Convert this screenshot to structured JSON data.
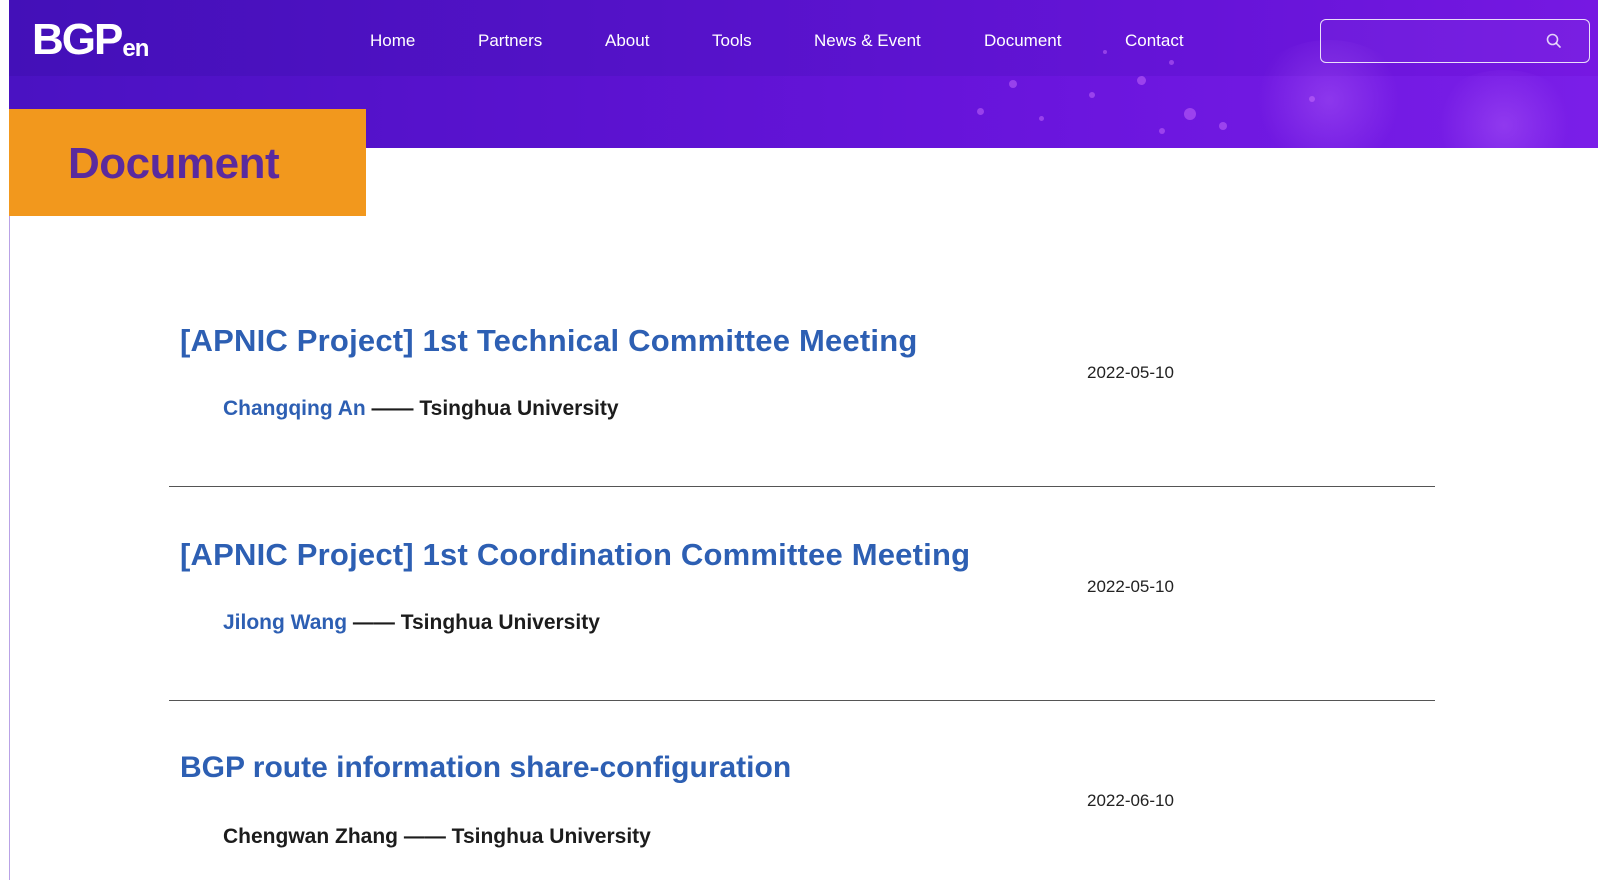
{
  "header": {
    "logo_main": "BGP",
    "logo_sub": "en",
    "nav": [
      {
        "label": "Home"
      },
      {
        "label": "Partners"
      },
      {
        "label": "About"
      },
      {
        "label": "Tools"
      },
      {
        "label": "News & Event"
      },
      {
        "label": "Document"
      },
      {
        "label": "Contact"
      }
    ],
    "search": {
      "value": "",
      "placeholder": "",
      "icon": "search-icon"
    }
  },
  "page": {
    "title": "Document"
  },
  "documents": [
    {
      "title": "[APNIC Project] 1st Technical Committee Meeting",
      "date": "2022-05-10",
      "author": "Changqing An",
      "separator": " —— ",
      "org": "Tsinghua University"
    },
    {
      "title": "[APNIC Project] 1st Coordination Committee Meeting",
      "date": "2022-05-10",
      "author": "Jilong Wang",
      "separator": " —— ",
      "org": "Tsinghua University"
    },
    {
      "title": "BGP route information share-configuration",
      "date": "2022-06-10",
      "author": "Chengwan Zhang",
      "separator": " —— ",
      "org": "Tsinghua University"
    }
  ],
  "colors": {
    "banner": "#5a12cf",
    "tab": "#f2981d",
    "tab_text": "#5a2a9e",
    "link": "#2d5fb3"
  }
}
